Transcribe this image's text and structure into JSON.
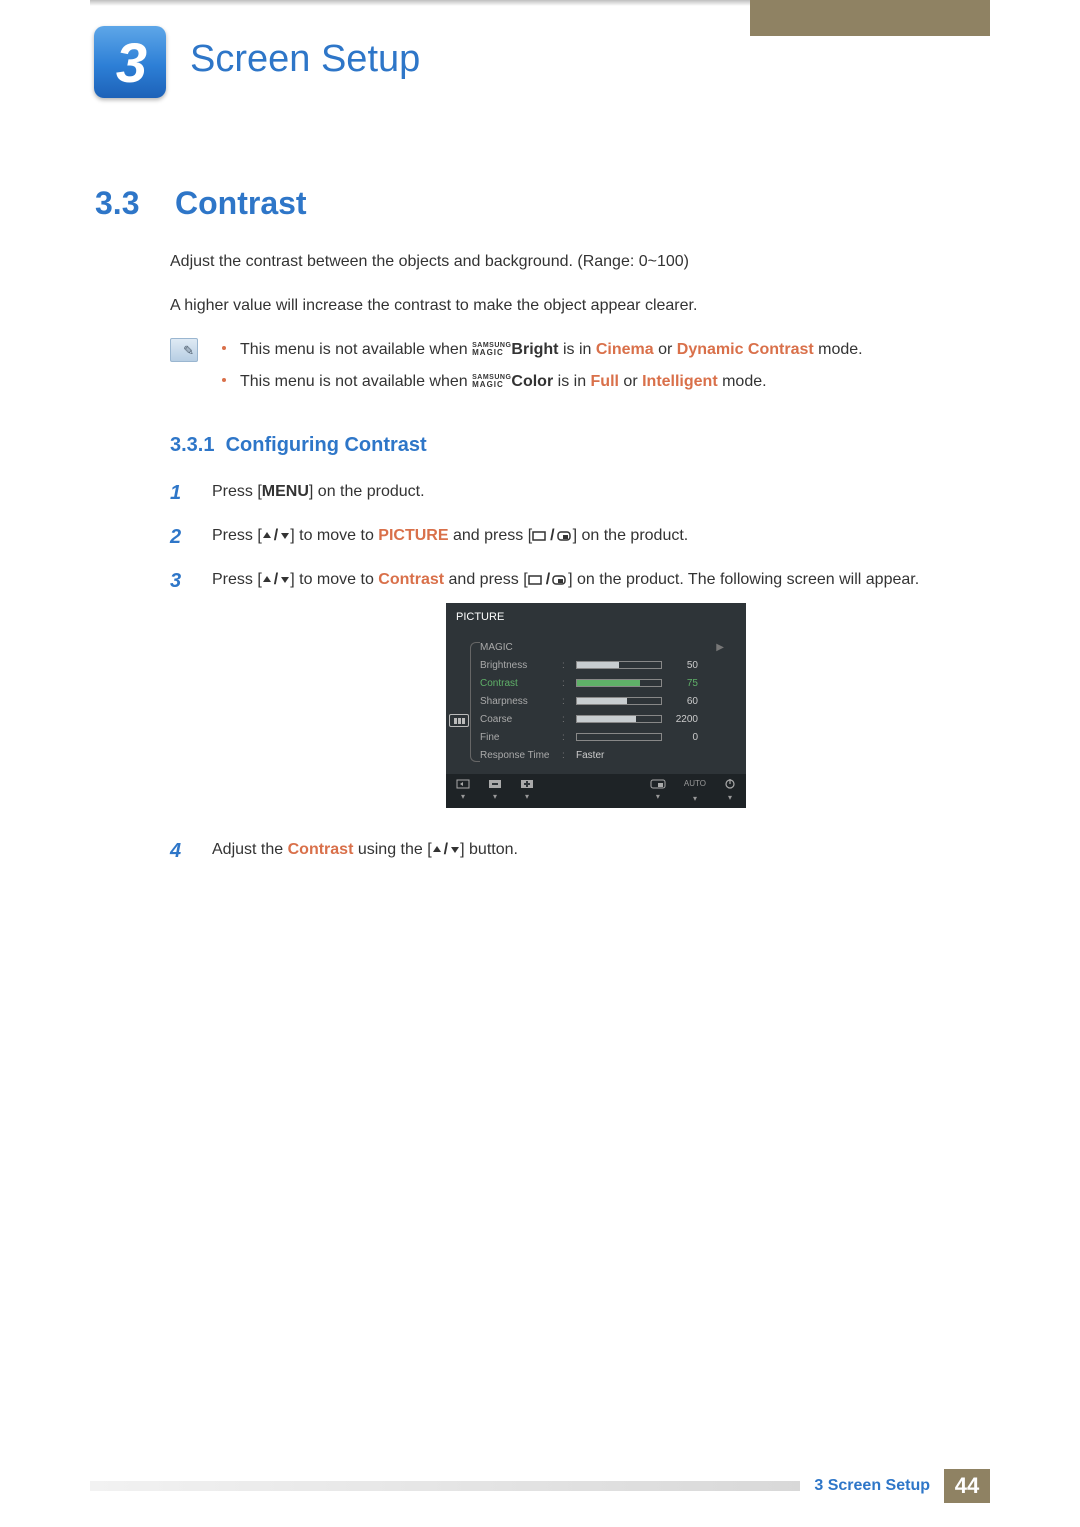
{
  "chapter": {
    "number": "3",
    "title": "Screen Setup"
  },
  "section": {
    "number": "3.3",
    "title": "Contrast"
  },
  "intro": {
    "p1": "Adjust the contrast between the objects and background. (Range: 0~100)",
    "p2": "A higher value will increase the contrast to make the object appear clearer."
  },
  "notes": {
    "magic_top": "SAMSUNG",
    "magic_bottom": "MAGIC",
    "n1_pre": "This menu is not available when ",
    "n1_suffix": "Bright",
    "n1_mid": " is in ",
    "n1_mode1": "Cinema",
    "n1_or": " or ",
    "n1_mode2": "Dynamic Contrast",
    "n1_end": " mode.",
    "n2_pre": "This menu is not available when ",
    "n2_suffix": "Color",
    "n2_mid": " is in ",
    "n2_mode1": "Full",
    "n2_or": " or ",
    "n2_mode2": "Intelligent",
    "n2_end": " mode."
  },
  "subsection": {
    "number": "3.3.1",
    "title": "Configuring Contrast"
  },
  "steps": {
    "s1_num": "1",
    "s1_a": "Press [",
    "s1_menu": "MENU",
    "s1_b": "] on the product.",
    "s2_num": "2",
    "s2_a": "Press [",
    "s2_b": "] to move to ",
    "s2_pic": "PICTURE",
    "s2_c": " and press [",
    "s2_d": "] on the product.",
    "s3_num": "3",
    "s3_a": "Press [",
    "s3_b": "] to move to ",
    "s3_con": "Contrast",
    "s3_c": " and press [",
    "s3_d": "] on the product. The following screen will appear.",
    "s4_num": "4",
    "s4_a": "Adjust the ",
    "s4_con": "Contrast",
    "s4_b": " using the [",
    "s4_c": "] button."
  },
  "chart_data": {
    "type": "table",
    "title": "PICTURE",
    "rows": [
      {
        "label": "MAGIC",
        "value": null,
        "value_text": "",
        "fill_pct": null,
        "selected": false
      },
      {
        "label": "Brightness",
        "value": 50,
        "value_text": "50",
        "fill_pct": 50,
        "selected": false
      },
      {
        "label": "Contrast",
        "value": 75,
        "value_text": "75",
        "fill_pct": 75,
        "selected": true
      },
      {
        "label": "Sharpness",
        "value": 60,
        "value_text": "60",
        "fill_pct": 60,
        "selected": false
      },
      {
        "label": "Coarse",
        "value": 2200,
        "value_text": "2200",
        "fill_pct": 70,
        "selected": false
      },
      {
        "label": "Fine",
        "value": 0,
        "value_text": "0",
        "fill_pct": 0,
        "selected": false
      },
      {
        "label": "Response Time",
        "value": null,
        "value_text": "Faster",
        "fill_pct": null,
        "selected": false
      }
    ],
    "footer_auto": "AUTO"
  },
  "footer": {
    "text": "3 Screen Setup",
    "page": "44"
  }
}
